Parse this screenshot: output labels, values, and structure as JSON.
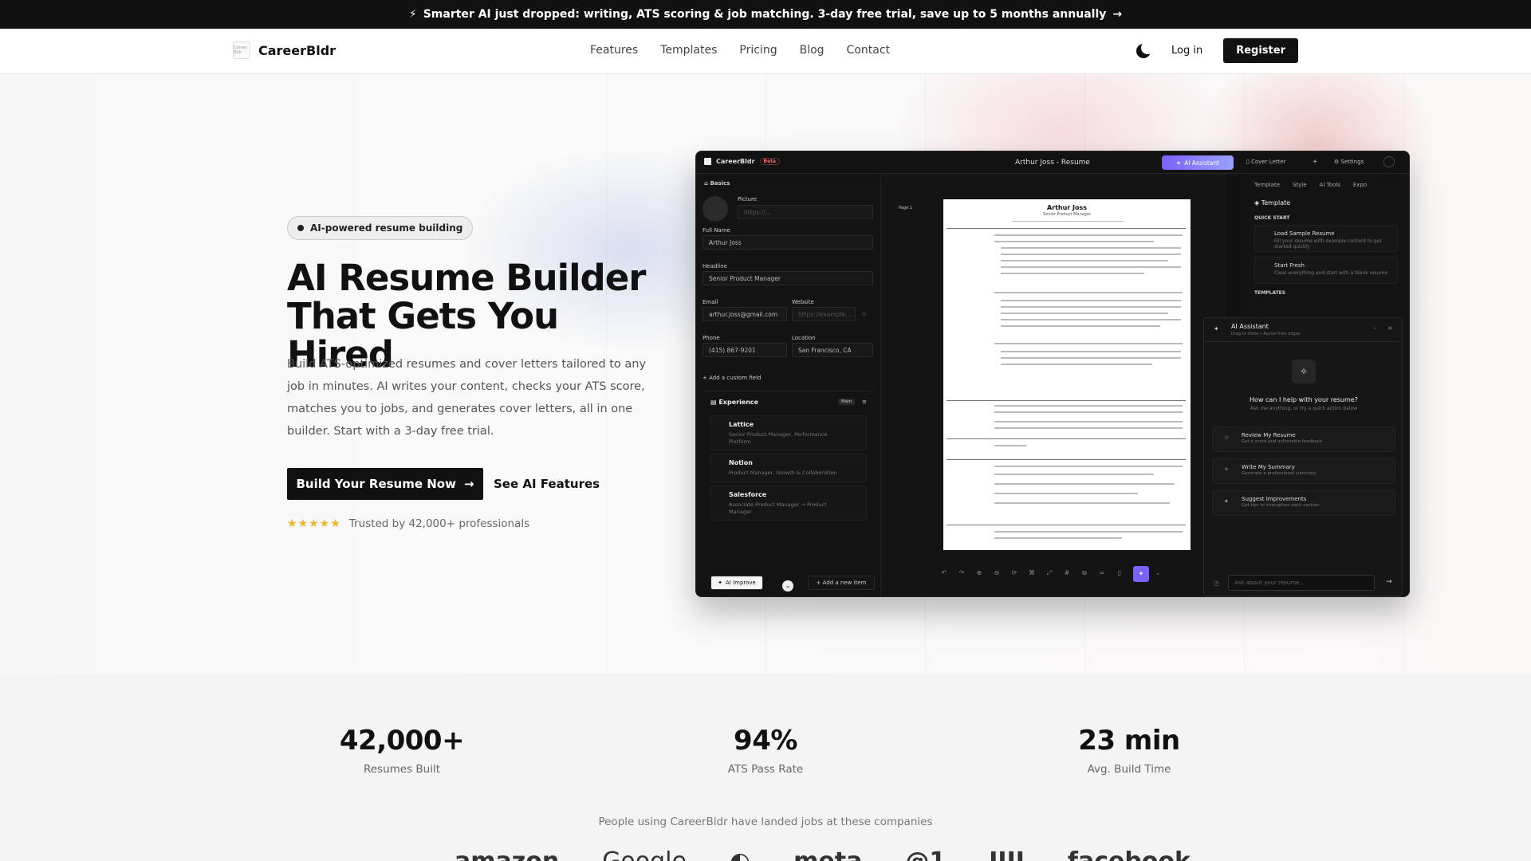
{
  "promo": {
    "text": "Smarter AI just dropped: writing, ATS scoring & job matching. 3-day free trial, save up to 5 months annually",
    "arrow": "→"
  },
  "nav": {
    "logo_text": "Career Bldr",
    "brand": "CareerBldr",
    "links": [
      "Features",
      "Templates",
      "Pricing",
      "Blog",
      "Contact"
    ],
    "login": "Log in",
    "register": "Register"
  },
  "hero": {
    "badge": "AI-powered resume building",
    "title_line1": "AI Resume Builder",
    "title_line2": "That Gets You Hired",
    "lede": "Build ATS-optimized resumes and cover letters tailored to any job in minutes. AI writes your content, checks your ATS score, matches you to jobs, and generates cover letters, all in one builder. Start with a 3-day free trial.",
    "cta_primary": "Build Your Resume Now",
    "cta_secondary": "See AI Features",
    "stars": "★★★★★",
    "trust": "Trusted by 42,000+ professionals"
  },
  "mock": {
    "app": "CareerBldr",
    "beta": "Beta",
    "title": "Arthur Joss - Resume",
    "ai_assistant": "AI Assistant",
    "cover_letter": "Cover Letter",
    "settings": "Settings",
    "basics": "Basics",
    "picture": "Picture",
    "picture_ph": "https://...",
    "full_name_label": "Full Name",
    "full_name": "Arthur Joss",
    "headline_label": "Headline",
    "headline": "Senior Product Manager",
    "email_label": "Email",
    "email": "arthur.joss@gmail.com",
    "website_label": "Website",
    "website_ph": "https://example...",
    "phone_label": "Phone",
    "phone": "(415) 867-9201",
    "location_label": "Location",
    "location": "San Francisco, CA",
    "add_custom": "+ Add a custom field",
    "experience": "Experience",
    "main": "Main",
    "jobs": [
      {
        "company": "Lattice",
        "role": "Senior Product Manager, Performance Platform"
      },
      {
        "company": "Notion",
        "role": "Product Manager, Growth & Collaboration"
      },
      {
        "company": "Salesforce",
        "role": "Associate Product Manager → Product Manager"
      }
    ],
    "ai_improve": "AI Improve",
    "add_item": "+ Add a new item",
    "page_label": "Page 1",
    "resume_name": "Arthur Joss",
    "resume_headline": "Senior Product Manager",
    "tabs": [
      "Template",
      "Style",
      "AI Tools",
      "Expo"
    ],
    "template_heading": "Template",
    "quick_start": "QUICK START",
    "load_sample": "Load Sample Resume",
    "load_sample_sub": "Fill your resume with example content to get started quickly",
    "start_fresh": "Start Fresh",
    "start_fresh_sub": "Clear everything and start with a blank resume",
    "templates": "TEMPLATES",
    "ai_title": "AI Assistant",
    "ai_sub": "Drag to move • Resize from edges",
    "ai_q": "How can I help with your resume?",
    "ai_q_sub": "Ask me anything, or try a quick action below",
    "actions": [
      {
        "t": "Review My Resume",
        "s": "Get a score and actionable feedback"
      },
      {
        "t": "Write My Summary",
        "s": "Generate a professional summary"
      },
      {
        "t": "Suggest Improvements",
        "s": "Get tips to strengthen each section"
      }
    ],
    "ai_input_ph": "Ask about your resume..."
  },
  "stats": [
    {
      "value": "42,000+",
      "label": "Resumes Built"
    },
    {
      "value": "94%",
      "label": "ATS Pass Rate"
    },
    {
      "value": "23 min",
      "label": "Avg. Build Time"
    }
  ],
  "companies": {
    "title": "People using CareerBldr have landed jobs at these companies",
    "logos": [
      "amazon",
      "Google",
      "◐",
      "meta",
      "@1",
      "IIII",
      "facebook"
    ]
  }
}
